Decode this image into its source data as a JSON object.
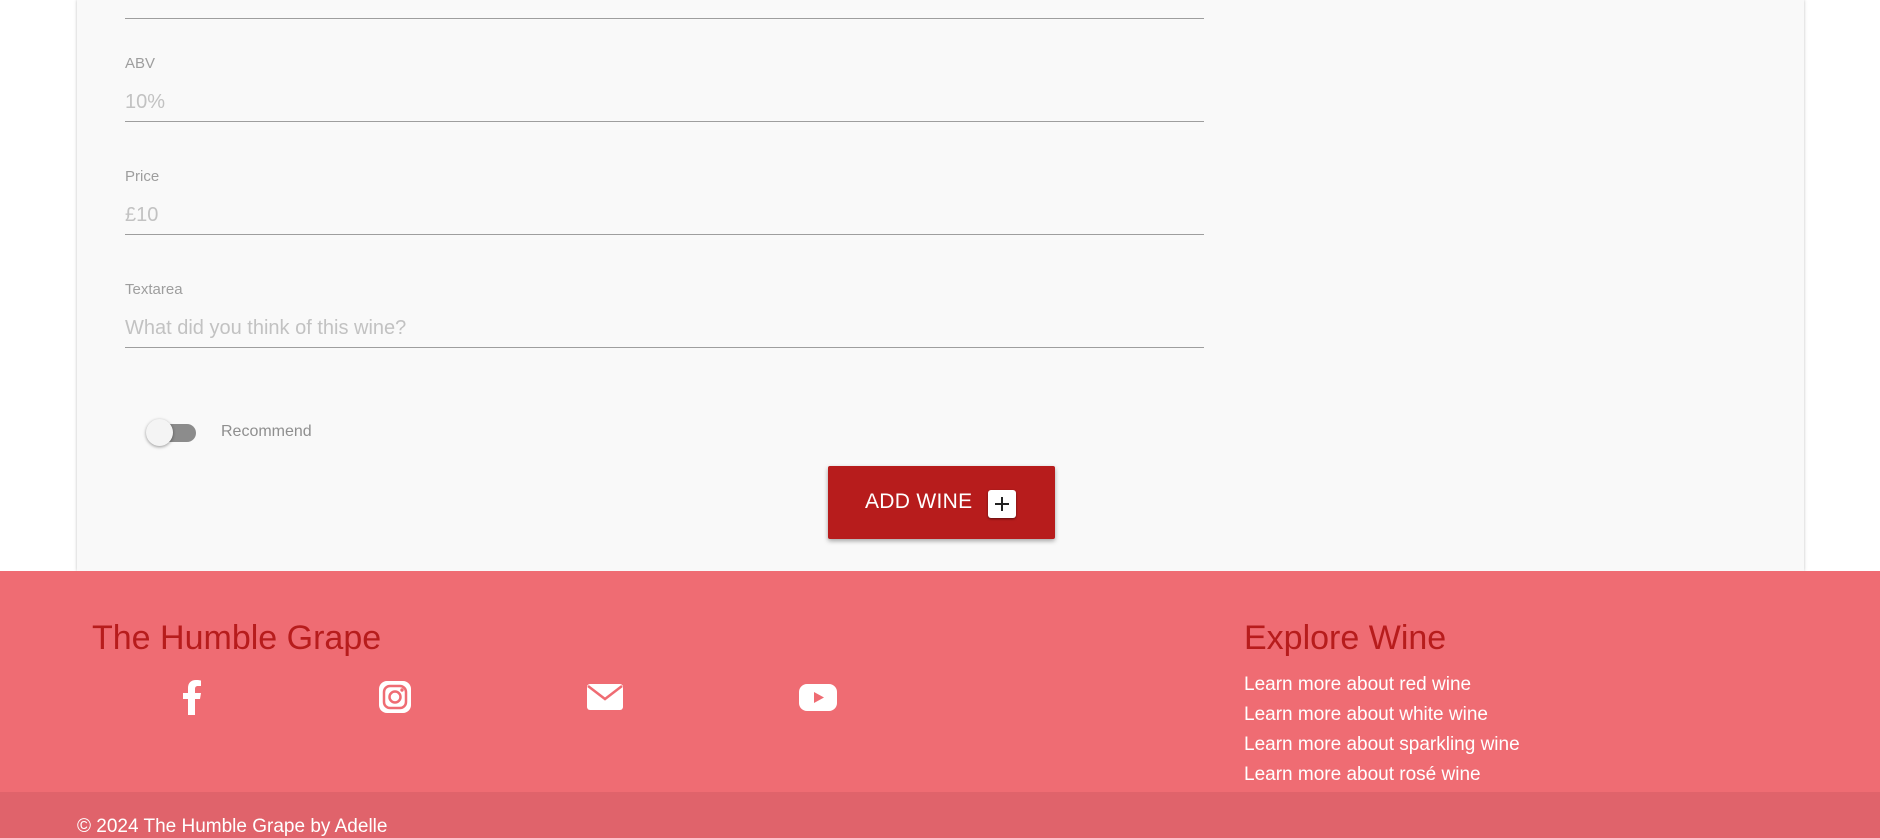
{
  "form": {
    "abv": {
      "label": "ABV",
      "placeholder": "10%"
    },
    "price": {
      "label": "Price",
      "placeholder": "£10"
    },
    "textarea": {
      "label": "Textarea",
      "placeholder": "What did you think of this wine?"
    },
    "recommend": {
      "label": "Recommend",
      "checked": false
    },
    "add_button": {
      "label": "ADD WINE",
      "icon": "plus-icon"
    }
  },
  "footer": {
    "brand_title": "The Humble Grape",
    "social_icons": [
      "facebook-icon",
      "instagram-icon",
      "envelope-icon",
      "youtube-icon"
    ],
    "explore_title": "Explore Wine",
    "links": [
      "Learn more about red wine",
      "Learn more about white wine",
      "Learn more about sparkling wine",
      "Learn more about rosé wine"
    ],
    "copyright": "© 2024 The Humble Grape by Adelle"
  },
  "colors": {
    "accent_red": "#b71c1c",
    "footer_bg": "#ef6c73",
    "copyright_bg": "#e0636b",
    "card_bg": "#f9f9f9"
  }
}
